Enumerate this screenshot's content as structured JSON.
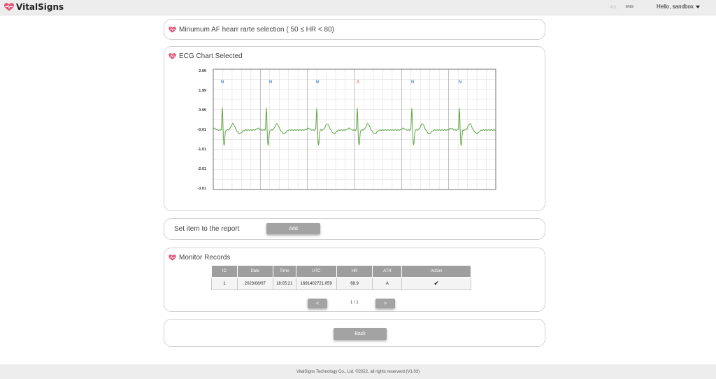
{
  "brand": {
    "name": "VitalSigns"
  },
  "header": {
    "lang_zh": "中文",
    "lang_en": "ENG",
    "user": "Hello, sandbox"
  },
  "selection": {
    "title": "Minumum AF hearr rarte selection ( 50 ≤ HR < 80)"
  },
  "ecg": {
    "title": "ECG Chart Selected",
    "y_ticks": [
      "2.99",
      "1.99",
      "0.99",
      "-0.01",
      "-1.01",
      "-2.01",
      "-3.01"
    ],
    "beats": [
      {
        "label": "N",
        "color": "#4a90d9"
      },
      {
        "label": "N",
        "color": "#4a90d9"
      },
      {
        "label": "N",
        "color": "#4a90d9"
      },
      {
        "label": "A",
        "color": "#e57373"
      },
      {
        "label": "N",
        "color": "#4a90d9"
      },
      {
        "label": "N",
        "color": "#4a90d9"
      }
    ],
    "line_color": "#6aaa4f"
  },
  "report": {
    "label": "Set item to the report",
    "add_button": "Add"
  },
  "records": {
    "title": "Monitor Records",
    "columns": [
      "ID",
      "Date",
      "Time",
      "UTC",
      "HR",
      "ATR",
      "Action"
    ],
    "rows": [
      [
        "1",
        "2023/08/07",
        "18:05:21",
        "1691402721.059",
        "68.9",
        "A",
        "✔"
      ]
    ],
    "prev": "<",
    "page": "1 / 1",
    "next": ">"
  },
  "back_button": "Back",
  "footer": "VitalSigns Technology Co., Ltd. ©2022, all rights reserverd (V1.03)",
  "colors": {
    "brand": "#e2567a"
  }
}
